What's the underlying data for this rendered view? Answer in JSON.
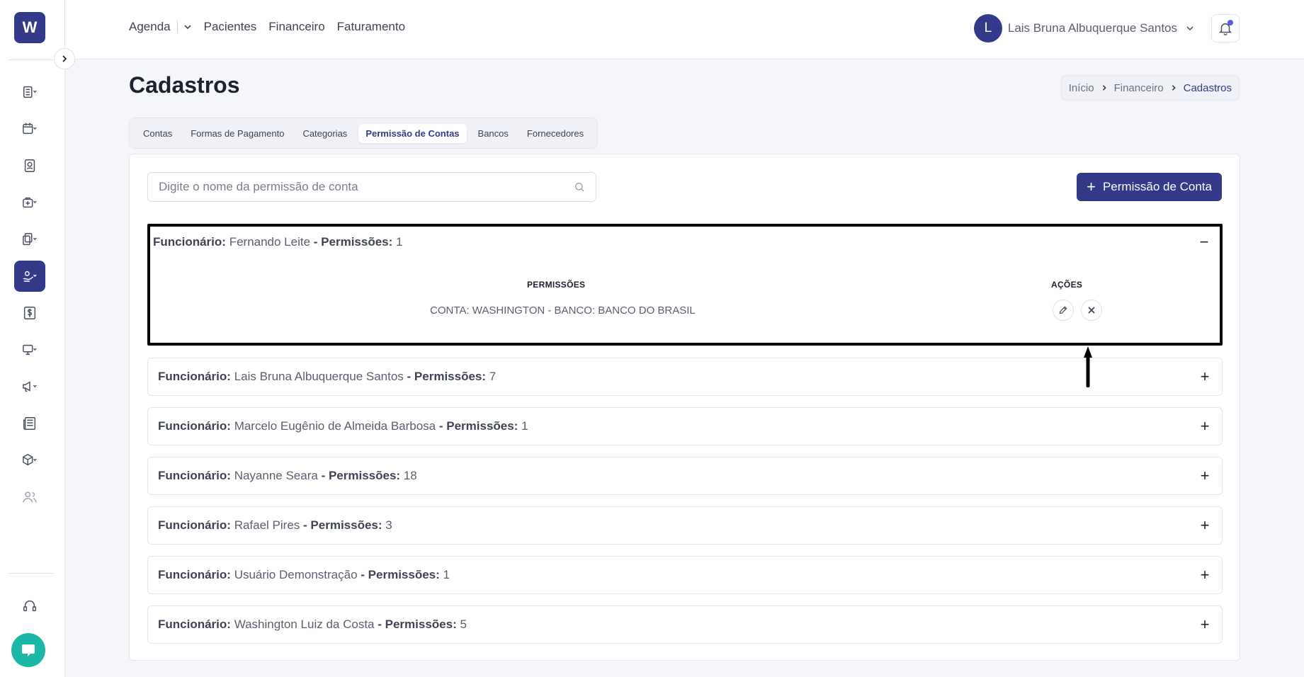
{
  "app": {
    "logo_letter": "W",
    "brand_color": "#333a8a"
  },
  "sidebar": {
    "items": [
      {
        "icon": "list-icon"
      },
      {
        "icon": "calendar-icon"
      },
      {
        "icon": "contact-card-icon"
      },
      {
        "icon": "medical-kit-icon"
      },
      {
        "icon": "documents-icon"
      },
      {
        "icon": "hand-money-icon",
        "active": true
      },
      {
        "icon": "dollar-sign-icon"
      },
      {
        "icon": "monitor-icon"
      },
      {
        "icon": "megaphone-icon"
      },
      {
        "icon": "newspaper-icon"
      },
      {
        "icon": "package-icon"
      },
      {
        "icon": "users-icon"
      },
      {
        "icon": "headset-icon"
      }
    ]
  },
  "topnav": {
    "agenda": "Agenda",
    "pacientes": "Pacientes",
    "financeiro": "Financeiro",
    "faturamento": "Faturamento"
  },
  "user": {
    "initial": "L",
    "name": "Lais Bruna Albuquerque Santos"
  },
  "page": {
    "title": "Cadastros"
  },
  "breadcrumb": {
    "home": "Início",
    "section": "Financeiro",
    "current": "Cadastros"
  },
  "tabs": [
    "Contas",
    "Formas de Pagamento",
    "Categorias",
    "Permissão de Contas",
    "Bancos",
    "Fornecedores"
  ],
  "active_tab": "Permissão de Contas",
  "search": {
    "placeholder": "Digite o nome da permissão de conta"
  },
  "add_button": {
    "label": "Permissão de Conta"
  },
  "labels": {
    "employee": "Funcionário:",
    "permissions": "- Permissões:"
  },
  "table": {
    "col_permissions": "PERMISSÕES",
    "col_actions": "AÇÕES"
  },
  "employees": [
    {
      "name": "Fernando Leite",
      "count": "1",
      "open": true,
      "permissions": [
        "CONTA: WASHINGTON - BANCO: BANCO DO BRASIL"
      ]
    },
    {
      "name": "Lais Bruna Albuquerque Santos",
      "count": "7"
    },
    {
      "name": "Marcelo Eugênio de Almeida Barbosa",
      "count": "1"
    },
    {
      "name": "Nayanne Seara",
      "count": "18"
    },
    {
      "name": "Rafael Pires",
      "count": "3"
    },
    {
      "name": "Usuário Demonstração",
      "count": "1"
    },
    {
      "name": "Washington Luiz da Costa",
      "count": "5"
    }
  ]
}
